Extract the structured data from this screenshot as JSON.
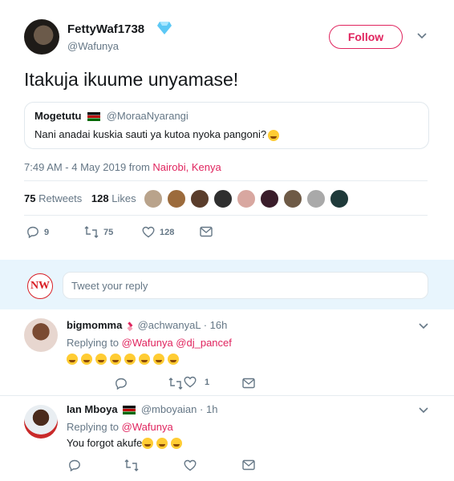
{
  "tweet": {
    "display_name": "FettyWaf1738",
    "handle": "@Wafunya",
    "follow_label": "Follow",
    "text": "Itakuja ikuume unyamase!",
    "quote": {
      "name": "Mogetutu",
      "handle": "@MoraaNyarangi",
      "text": "Nani anadai kuskia sauti ya kutoa nyoka pangoni?"
    },
    "time": "7:49 AM - 4 May 2019 from",
    "location": "Nairobi, Kenya",
    "retweets_count": "75",
    "retweets_label": "Retweets",
    "likes_count": "128",
    "likes_label": "Likes",
    "actions": {
      "replies": "9",
      "retweets": "75",
      "likes": "128"
    }
  },
  "reply_box": {
    "placeholder": "Tweet your reply",
    "logo_text": "NW"
  },
  "replies": [
    {
      "name": "bigmomma",
      "handle": "@achwanyaL",
      "time": "· 16h",
      "replying_prefix": "Replying to",
      "mentions": "@Wafunya @dj_pancef",
      "text": "",
      "emoji_count": 8,
      "actions": {
        "replies": "",
        "retweets": "",
        "likes": "1"
      }
    },
    {
      "name": "Ian Mboya",
      "handle": "@mboyaian",
      "time": "· 1h",
      "replying_prefix": "Replying to",
      "mentions": "@Wafunya",
      "text": "You forgot akufe",
      "emoji_count": 3,
      "actions": {
        "replies": "",
        "retweets": "",
        "likes": ""
      }
    }
  ],
  "colors": {
    "accent": "#e0245e",
    "blue": "#1da1f2",
    "muted": "#657786",
    "border": "#e1e8ed"
  }
}
